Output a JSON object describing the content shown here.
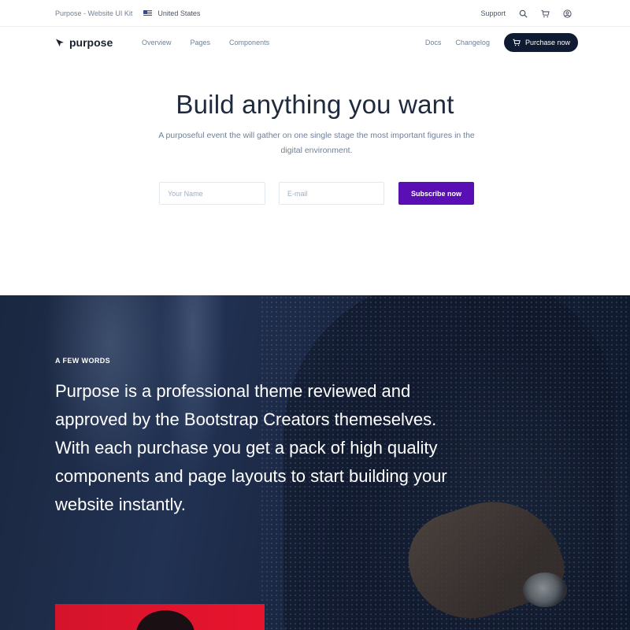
{
  "topbar": {
    "kit_label": "Purpose - Website UI Kit",
    "country": "United States",
    "support_label": "Support",
    "flag_icon": "us-flag-icon",
    "icons": [
      "search-icon",
      "cart-icon",
      "user-icon"
    ]
  },
  "nav": {
    "brand": "purpose",
    "links": [
      "Overview",
      "Pages",
      "Components"
    ],
    "right_links": [
      "Docs",
      "Changelog"
    ],
    "purchase_label": "Purchase now",
    "purchase_icon": "cart-icon"
  },
  "hero": {
    "title": "Build anything you want",
    "subtitle": "A purposeful event the will gather on one single stage the most important figures in the digital environment.",
    "name_placeholder": "Your Name",
    "email_placeholder": "E-mail",
    "subscribe_label": "Subscribe now"
  },
  "about": {
    "eyebrow": "A FEW WORDS",
    "text": "Purpose is a professional theme reviewed and approved by the Bootstrap Creators themeselves. With each purchase you get a pack of high quality components and page layouts to start building your website instantly."
  },
  "colors": {
    "primary_dark": "#0f1b33",
    "accent_purple": "#5a0fb5",
    "section_dark": "#1a2740",
    "card_red": "#e8142e"
  }
}
